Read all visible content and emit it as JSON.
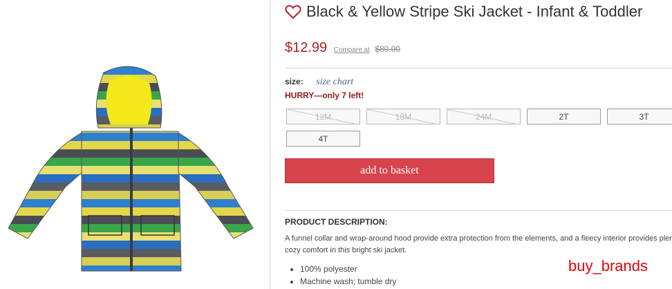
{
  "product": {
    "title": "Black & Yellow Stripe Ski Jacket - Infant & Toddler",
    "price": "$12.99",
    "compare_label": "Compare at",
    "compare_price": "$80.00",
    "favorite_icon": "heart-outline-icon",
    "image_name": "striped ski jacket with yellow hood"
  },
  "size": {
    "label": "size:",
    "chart_link": "size chart",
    "hurry": "HURRY—only 7 left!",
    "options": [
      {
        "label": "12M",
        "available": false
      },
      {
        "label": "18M",
        "available": false
      },
      {
        "label": "24M",
        "available": false
      },
      {
        "label": "2T",
        "available": true
      },
      {
        "label": "3T",
        "available": true
      },
      {
        "label": "4T",
        "available": true
      }
    ]
  },
  "actions": {
    "add_to_basket": "add to basket"
  },
  "description": {
    "heading": "PRODUCT DESCRIPTION:",
    "text": "A funnel collar and wrap-around hood provide extra protection from the elements, and a fleecy interior provides plenty of cozy comfort in this bright ski jacket.",
    "bullets": [
      "100% polyester",
      "Machine wash; tumble dry"
    ]
  },
  "watermark": "buy_brands",
  "colors": {
    "price": "#b51f24",
    "button": "#d8444b",
    "hurry": "#8b1a1a",
    "link": "#4a6a8a",
    "watermark": "#e3000b"
  }
}
